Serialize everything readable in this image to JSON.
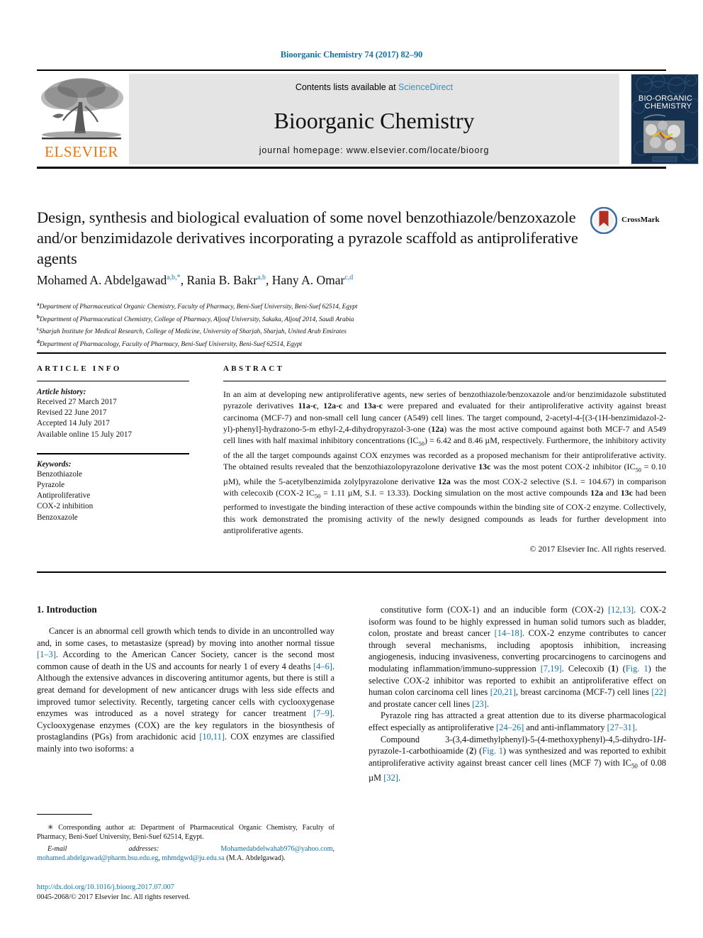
{
  "running_head": "Bioorganic Chemistry 74 (2017) 82–90",
  "masthead": {
    "elsevier_wordmark": "ELSEVIER",
    "contents_prefix": "Contents lists available at ",
    "contents_link": "ScienceDirect",
    "journal_name": "Bioorganic Chemistry",
    "journal_homepage": "journal homepage: www.elsevier.com/locate/bioorg",
    "cover_line1": "BIO-ORGANIC",
    "cover_line2": "CHEMISTRY"
  },
  "crossmark": {
    "label": "CrossMark"
  },
  "article": {
    "title": "Design, synthesis and biological evaluation of some novel benzothiazole/benzoxazole and/or benzimidazole derivatives incorporating a pyrazole scaffold as antiproliferative agents",
    "authors": [
      {
        "name": "Mohamed A. Abdelgawad",
        "marks": "a,b,*"
      },
      {
        "name": "Rania B. Bakr",
        "marks": "a,b"
      },
      {
        "name": "Hany A. Omar",
        "marks": "c,d"
      }
    ],
    "affiliations": [
      {
        "mark": "a",
        "text": "Department of Pharmaceutical Organic Chemistry, Faculty of Pharmacy, Beni-Suef University, Beni-Suef 62514, Egypt"
      },
      {
        "mark": "b",
        "text": "Department of Pharmaceutical Chemistry, College of Pharmacy, Aljouf University, Sakaka, Aljouf 2014, Saudi Arabia"
      },
      {
        "mark": "c",
        "text": "Sharjah Institute for Medical Research, College of Medicine, University of Sharjah, Sharjah, United Arab Emirates"
      },
      {
        "mark": "d",
        "text": "Department of Pharmacology, Faculty of Pharmacy, Beni-Suef University, Beni-Suef 62514, Egypt"
      }
    ]
  },
  "article_info": {
    "heading": "ARTICLE INFO",
    "history_label": "Article history:",
    "history": [
      "Received 27 March 2017",
      "Revised 22 June 2017",
      "Accepted 14 July 2017",
      "Available online 15 July 2017"
    ],
    "keywords_label": "Keywords:",
    "keywords": [
      "Benzothiazole",
      "Pyrazole",
      "Antiproliferative",
      "COX-2 inhibition",
      "Benzoxazole"
    ]
  },
  "abstract": {
    "heading": "ABSTRACT",
    "body_html": "In an aim at developing new antiproliferative agents, new series of benzothiazole/benzoxazole and/or benzimidazole substituted pyrazole derivatives <b>11a-c</b>, <b>12a-c</b> and <b>13a-c</b> were prepared and evaluated for their antiproliferative activity against breast carcinoma (MCF-7) and non-small cell lung cancer (A549) cell lines. The target compound, 2-acetyl-4-[(3-(1H-benzimidazol-2-yl)-phenyl]-hydrazono-5-m ethyl-2,4-dihydropyrazol-3-one (<b>12a</b>) was the most active compound against both MCF-7 and A549 cell lines with half maximal inhibitory concentrations (IC<sub>50</sub>) = 6.42 and 8.46 &micro;M, respectively. Furthermore, the inhibitory activity of the all the target compounds against COX enzymes was recorded as a proposed mechanism for their antiproliferative activity. The obtained results revealed that the benzothiazolopyrazolone derivative <b>13c</b> was the most potent COX-2 inhibitor (IC<sub>50</sub> = 0.10 &micro;M), while the 5-acetylbenzimida zolylpyrazolone derivative <b>12a</b> was the most COX-2 selective (S.I. = 104.67) in comparison with celecoxib (COX-2 IC<sub>50</sub> = 1.11 &micro;M, S.I. = 13.33). Docking simulation on the most active compounds <b>12a</b> and <b>13c</b> had been performed to investigate the binding interaction of these active compounds within the binding site of COX-2 enzyme. Collectively, this work demonstrated the promising activity of the newly designed compounds as leads for further development into antiproliferative agents.",
    "copyright": "© 2017 Elsevier Inc. All rights reserved."
  },
  "body": {
    "section_heading": "1. Introduction",
    "left_paragraphs_html": [
      "Cancer is an abnormal cell growth which tends to divide in an uncontrolled way and, in some cases, to metastasize (spread) by moving into another normal tissue <span class=\"ref\">[1–3]</span>. According to the American Cancer Society, cancer is the second most common cause of death in the US and accounts for nearly 1 of every 4 deaths <span class=\"ref\">[4–6]</span>. Although the extensive advances in discovering antitumor agents, but there is still a great demand for development of new anticancer drugs with less side effects and improved tumor selectivity. Recently, targeting cancer cells with cyclooxygenase enzymes was introduced as a novel strategy for cancer treatment <span class=\"ref\">[7–9]</span>. Cyclooxygenase enzymes (COX) are the key regulators in the biosynthesis of prostaglandins (PGs) from arachidonic acid <span class=\"ref\">[10,11]</span>. COX enzymes are classified mainly into two isoforms: a"
    ],
    "right_paragraphs_html": [
      "constitutive form (COX-1) and an inducible form (COX-2) <span class=\"ref\">[12,13]</span>. COX-2 isoform was found to be highly expressed in human solid tumors such as bladder, colon, prostate and breast cancer <span class=\"ref\">[14–18]</span>. COX-2 enzyme contributes to cancer through several mechanisms, including apoptosis inhibition, increasing angiogenesis, inducing invasiveness, converting procarcinogens to carcinogens and modulating inflammation/immuno-suppression <span class=\"ref\">[7,19]</span>. Celecoxib (<b>1</b>) (<span class=\"ref\">Fig. 1</span>) the selective COX-2 inhibitor was reported to exhibit an antiproliferative effect on human colon carcinoma cell lines <span class=\"ref\">[20,21]</span>, breast carcinoma (MCF-7) cell lines <span class=\"ref\">[22]</span> and prostate cancer cell lines <span class=\"ref\">[23]</span>.",
      "Pyrazole ring has attracted a great attention due to its diverse pharmacological effect especially as antiproliferative <span class=\"ref\">[24–26]</span> and anti-inflammatory <span class=\"ref\">[27–31]</span>.",
      "Compound 3-(3,4-dimethylphenyl)-5-(4-methoxyphenyl)-4,5-dihydro-1<i>H</i>-pyrazole-1-carbothioamide (<b>2</b>) (<span class=\"ref\">Fig. 1</span>) was synthesized and was reported to exhibit antiproliferative activity against breast cancer cell lines (MCF 7) with IC<sub>50</sub> of 0.08 &micro;M <span class=\"ref\">[32]</span>."
    ]
  },
  "footnote": {
    "corresponding_html": "&#10035; Corresponding author at: Department of Pharmaceutical Organic Chemistry, Faculty of Pharmacy, Beni-Suef University, Beni-Suef 62514, Egypt.",
    "email_html": "<i>E-mail addresses:</i> <span class=\"mail\">Mohamedabdelwahab976@yahoo.com</span>, <span class=\"mail\">mohamed.abdelgawad@pharm.bsu.edu.eg</span>, <span class=\"mail\">mhmdgwd@ju.edu.sa</span> (M.A. Abdelgawad).",
    "doi": "http://dx.doi.org/10.1016/j.bioorg.2017.07.007",
    "issn_html": "0045-2068/&copy; 2017 Elsevier Inc. All rights reserved."
  },
  "colors": {
    "link_blue": "#1571a5",
    "sciencedirect_blue": "#3b8fc7",
    "elsevier_orange": "#ec7404",
    "band_gray": "#e4e4e4",
    "crossmark_red": "#b02e26"
  }
}
